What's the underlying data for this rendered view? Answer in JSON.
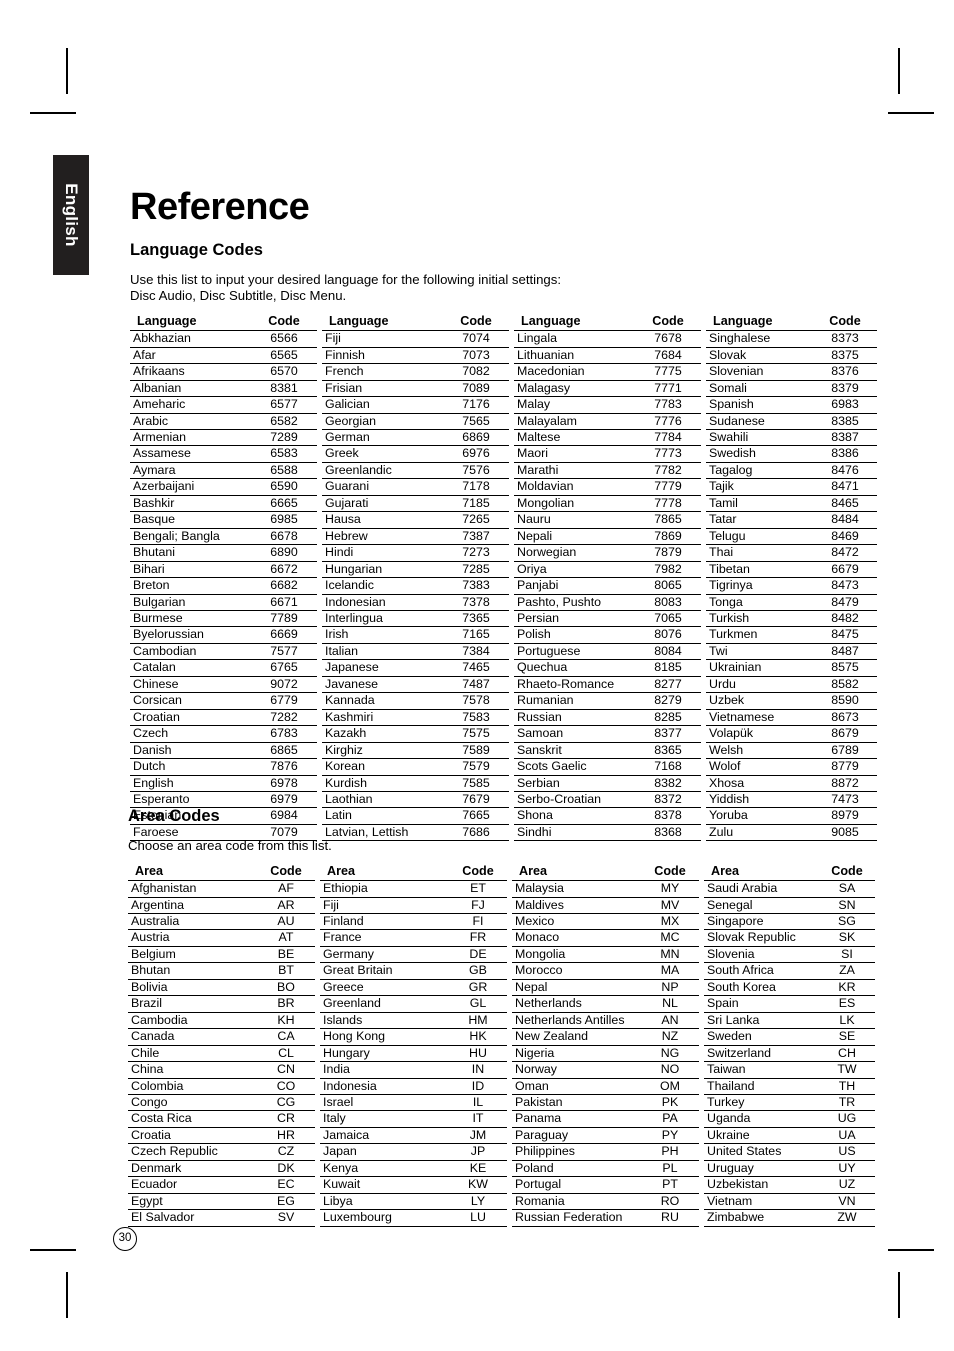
{
  "page": {
    "language_tab": "English",
    "title": "Reference",
    "page_number": "30"
  },
  "language_section": {
    "heading": "Language Codes",
    "description_line1": "Use this list to input your desired language for the following initial settings:",
    "description_line2": "Disc Audio, Disc Subtitle, Disc Menu.",
    "columns": {
      "name_header": "Language",
      "code_header": "Code"
    },
    "tables": [
      {
        "rows": [
          [
            "Abkhazian",
            "6566"
          ],
          [
            "Afar",
            "6565"
          ],
          [
            "Afrikaans",
            "6570"
          ],
          [
            "Albanian",
            "8381"
          ],
          [
            "Ameharic",
            "6577"
          ],
          [
            "Arabic",
            "6582"
          ],
          [
            "Armenian",
            "7289"
          ],
          [
            "Assamese",
            "6583"
          ],
          [
            "Aymara",
            "6588"
          ],
          [
            "Azerbaijani",
            "6590"
          ],
          [
            "Bashkir",
            "6665"
          ],
          [
            "Basque",
            "6985"
          ],
          [
            "Bengali; Bangla",
            "6678"
          ],
          [
            "Bhutani",
            "6890"
          ],
          [
            "Bihari",
            "6672"
          ],
          [
            "Breton",
            "6682"
          ],
          [
            "Bulgarian",
            "6671"
          ],
          [
            "Burmese",
            "7789"
          ],
          [
            "Byelorussian",
            "6669"
          ],
          [
            "Cambodian",
            "7577"
          ],
          [
            "Catalan",
            "6765"
          ],
          [
            "Chinese",
            "9072"
          ],
          [
            "Corsican",
            "6779"
          ],
          [
            "Croatian",
            "7282"
          ],
          [
            "Czech",
            "6783"
          ],
          [
            "Danish",
            "6865"
          ],
          [
            "Dutch",
            "7876"
          ],
          [
            "English",
            "6978"
          ],
          [
            "Esperanto",
            "6979"
          ],
          [
            "Estonian",
            "6984"
          ],
          [
            "Faroese",
            "7079"
          ]
        ]
      },
      {
        "rows": [
          [
            "Fiji",
            "7074"
          ],
          [
            "Finnish",
            "7073"
          ],
          [
            "French",
            "7082"
          ],
          [
            "Frisian",
            "7089"
          ],
          [
            "Galician",
            "7176"
          ],
          [
            "Georgian",
            "7565"
          ],
          [
            "German",
            "6869"
          ],
          [
            "Greek",
            "6976"
          ],
          [
            "Greenlandic",
            "7576"
          ],
          [
            "Guarani",
            "7178"
          ],
          [
            "Gujarati",
            "7185"
          ],
          [
            "Hausa",
            "7265"
          ],
          [
            "Hebrew",
            "7387"
          ],
          [
            "Hindi",
            "7273"
          ],
          [
            "Hungarian",
            "7285"
          ],
          [
            "Icelandic",
            "7383"
          ],
          [
            "Indonesian",
            "7378"
          ],
          [
            "Interlingua",
            "7365"
          ],
          [
            "Irish",
            "7165"
          ],
          [
            "Italian",
            "7384"
          ],
          [
            "Japanese",
            "7465"
          ],
          [
            "Javanese",
            "7487"
          ],
          [
            "Kannada",
            "7578"
          ],
          [
            "Kashmiri",
            "7583"
          ],
          [
            "Kazakh",
            "7575"
          ],
          [
            "Kirghiz",
            "7589"
          ],
          [
            "Korean",
            "7579"
          ],
          [
            "Kurdish",
            "7585"
          ],
          [
            "Laothian",
            "7679"
          ],
          [
            "Latin",
            "7665"
          ],
          [
            "Latvian, Lettish",
            "7686"
          ]
        ]
      },
      {
        "rows": [
          [
            "Lingala",
            "7678"
          ],
          [
            "Lithuanian",
            "7684"
          ],
          [
            "Macedonian",
            "7775"
          ],
          [
            "Malagasy",
            "7771"
          ],
          [
            "Malay",
            "7783"
          ],
          [
            "Malayalam",
            "7776"
          ],
          [
            "Maltese",
            "7784"
          ],
          [
            "Maori",
            "7773"
          ],
          [
            "Marathi",
            "7782"
          ],
          [
            "Moldavian",
            "7779"
          ],
          [
            "Mongolian",
            "7778"
          ],
          [
            "Nauru",
            "7865"
          ],
          [
            "Nepali",
            "7869"
          ],
          [
            "Norwegian",
            "7879"
          ],
          [
            "Oriya",
            "7982"
          ],
          [
            "Panjabi",
            "8065"
          ],
          [
            "Pashto, Pushto",
            "8083"
          ],
          [
            "Persian",
            "7065"
          ],
          [
            "Polish",
            "8076"
          ],
          [
            "Portuguese",
            "8084"
          ],
          [
            "Quechua",
            "8185"
          ],
          [
            "Rhaeto-Romance",
            "8277"
          ],
          [
            "Rumanian",
            "8279"
          ],
          [
            "Russian",
            "8285"
          ],
          [
            "Samoan",
            "8377"
          ],
          [
            "Sanskrit",
            "8365"
          ],
          [
            "Scots Gaelic",
            "7168"
          ],
          [
            "Serbian",
            "8382"
          ],
          [
            "Serbo-Croatian",
            "8372"
          ],
          [
            "Shona",
            "8378"
          ],
          [
            "Sindhi",
            "8368"
          ]
        ]
      },
      {
        "rows": [
          [
            "Singhalese",
            "8373"
          ],
          [
            "Slovak",
            "8375"
          ],
          [
            "Slovenian",
            "8376"
          ],
          [
            "Somali",
            "8379"
          ],
          [
            "Spanish",
            "6983"
          ],
          [
            "Sudanese",
            "8385"
          ],
          [
            "Swahili",
            "8387"
          ],
          [
            "Swedish",
            "8386"
          ],
          [
            "Tagalog",
            "8476"
          ],
          [
            "Tajik",
            "8471"
          ],
          [
            "Tamil",
            "8465"
          ],
          [
            "Tatar",
            "8484"
          ],
          [
            "Telugu",
            "8469"
          ],
          [
            "Thai",
            "8472"
          ],
          [
            "Tibetan",
            "6679"
          ],
          [
            "Tigrinya",
            "8473"
          ],
          [
            "Tonga",
            "8479"
          ],
          [
            "Turkish",
            "8482"
          ],
          [
            "Turkmen",
            "8475"
          ],
          [
            "Twi",
            "8487"
          ],
          [
            "Ukrainian",
            "8575"
          ],
          [
            "Urdu",
            "8582"
          ],
          [
            "Uzbek",
            "8590"
          ],
          [
            "Vietnamese",
            "8673"
          ],
          [
            "Volapük",
            "8679"
          ],
          [
            "Welsh",
            "6789"
          ],
          [
            "Wolof",
            "8779"
          ],
          [
            "Xhosa",
            "8872"
          ],
          [
            "Yiddish",
            "7473"
          ],
          [
            "Yoruba",
            "8979"
          ],
          [
            "Zulu",
            "9085"
          ]
        ]
      }
    ]
  },
  "area_section": {
    "heading": "Area Codes",
    "description_line1": "Choose an area code from this list.",
    "columns": {
      "name_header": "Area",
      "code_header": "Code"
    },
    "tables": [
      {
        "rows": [
          [
            "Afghanistan",
            "AF"
          ],
          [
            "Argentina",
            "AR"
          ],
          [
            "Australia",
            "AU"
          ],
          [
            "Austria",
            "AT"
          ],
          [
            "Belgium",
            "BE"
          ],
          [
            "Bhutan",
            "BT"
          ],
          [
            "Bolivia",
            "BO"
          ],
          [
            "Brazil",
            "BR"
          ],
          [
            "Cambodia",
            "KH"
          ],
          [
            "Canada",
            "CA"
          ],
          [
            "Chile",
            "CL"
          ],
          [
            "China",
            "CN"
          ],
          [
            "Colombia",
            "CO"
          ],
          [
            "Congo",
            "CG"
          ],
          [
            "Costa Rica",
            "CR"
          ],
          [
            "Croatia",
            "HR"
          ],
          [
            "Czech Republic",
            "CZ"
          ],
          [
            "Denmark",
            "DK"
          ],
          [
            "Ecuador",
            "EC"
          ],
          [
            "Egypt",
            "EG"
          ],
          [
            "El Salvador",
            "SV"
          ]
        ]
      },
      {
        "rows": [
          [
            "Ethiopia",
            "ET"
          ],
          [
            "Fiji",
            "FJ"
          ],
          [
            "Finland",
            "FI"
          ],
          [
            "France",
            "FR"
          ],
          [
            "Germany",
            "DE"
          ],
          [
            "Great Britain",
            "GB"
          ],
          [
            "Greece",
            "GR"
          ],
          [
            "Greenland",
            "GL"
          ],
          [
            "Islands",
            "HM"
          ],
          [
            "Hong Kong",
            "HK"
          ],
          [
            "Hungary",
            "HU"
          ],
          [
            "India",
            "IN"
          ],
          [
            "Indonesia",
            "ID"
          ],
          [
            "Israel",
            "IL"
          ],
          [
            "Italy",
            "IT"
          ],
          [
            "Jamaica",
            "JM"
          ],
          [
            "Japan",
            "JP"
          ],
          [
            "Kenya",
            "KE"
          ],
          [
            "Kuwait",
            "KW"
          ],
          [
            "Libya",
            "LY"
          ],
          [
            "Luxembourg",
            "LU"
          ]
        ]
      },
      {
        "rows": [
          [
            "Malaysia",
            "MY"
          ],
          [
            "Maldives",
            "MV"
          ],
          [
            "Mexico",
            "MX"
          ],
          [
            "Monaco",
            "MC"
          ],
          [
            "Mongolia",
            "MN"
          ],
          [
            "Morocco",
            "MA"
          ],
          [
            "Nepal",
            "NP"
          ],
          [
            "Netherlands",
            "NL"
          ],
          [
            "Netherlands Antilles",
            "AN"
          ],
          [
            "New Zealand",
            "NZ"
          ],
          [
            "Nigeria",
            "NG"
          ],
          [
            "Norway",
            "NO"
          ],
          [
            "Oman",
            "OM"
          ],
          [
            "Pakistan",
            "PK"
          ],
          [
            "Panama",
            "PA"
          ],
          [
            "Paraguay",
            "PY"
          ],
          [
            "Philippines",
            "PH"
          ],
          [
            "Poland",
            "PL"
          ],
          [
            "Portugal",
            "PT"
          ],
          [
            "Romania",
            "RO"
          ],
          [
            "Russian Federation",
            "RU"
          ]
        ]
      },
      {
        "rows": [
          [
            "Saudi Arabia",
            "SA"
          ],
          [
            "Senegal",
            "SN"
          ],
          [
            "Singapore",
            "SG"
          ],
          [
            "Slovak Republic",
            "SK"
          ],
          [
            "Slovenia",
            "SI"
          ],
          [
            "South Africa",
            "ZA"
          ],
          [
            "South Korea",
            "KR"
          ],
          [
            "Spain",
            "ES"
          ],
          [
            "Sri Lanka",
            "LK"
          ],
          [
            "Sweden",
            "SE"
          ],
          [
            "Switzerland",
            "CH"
          ],
          [
            "Taiwan",
            "TW"
          ],
          [
            "Thailand",
            "TH"
          ],
          [
            "Turkey",
            "TR"
          ],
          [
            "Uganda",
            "UG"
          ],
          [
            "Ukraine",
            "UA"
          ],
          [
            "United States",
            "US"
          ],
          [
            "Uruguay",
            "UY"
          ],
          [
            "Uzbekistan",
            "UZ"
          ],
          [
            "Vietnam",
            "VN"
          ],
          [
            "Zimbabwe",
            "ZW"
          ]
        ]
      }
    ]
  }
}
